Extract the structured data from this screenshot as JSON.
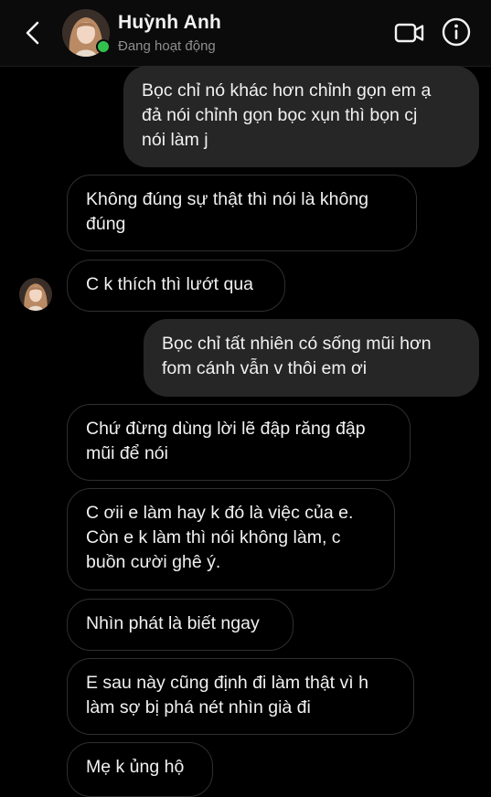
{
  "header": {
    "contact_name": "Huỳnh Anh",
    "status": "Đang hoạt động",
    "back_icon": "chevron-left-icon",
    "video_icon": "video-camera-icon",
    "info_icon": "info-icon",
    "online_color": "#31c24d"
  },
  "messages": [
    {
      "direction": "sent",
      "text": "Bọc chỉ nó khác hơn chỉnh gọn em ạ\nđả nói chỉnh gọn bọc xụn thì bọn cj\nnói làm j"
    },
    {
      "direction": "received",
      "text": "Không đúng sự thật thì nói là không\nđúng"
    },
    {
      "direction": "received",
      "text": "C k thích thì lướt qua"
    },
    {
      "direction": "sent",
      "text": "Bọc chỉ tất nhiên có sống mũi hơn\nfom cánh vẫn v thôi em ơi"
    },
    {
      "direction": "received",
      "text": "Chứ đừng dùng lời lẽ đập răng đập\nmũi để nói"
    },
    {
      "direction": "received",
      "text": "C ơii e làm hay k đó là việc của e.\nCòn e k làm thì nói không làm, c\nbuồn cười ghê ý."
    },
    {
      "direction": "received",
      "text": "Nhìn phát là biết ngay"
    },
    {
      "direction": "received",
      "text": "E sau này cũng định đi làm thật vì h\nlàm sợ bị phá nét nhìn già đi"
    },
    {
      "direction": "received",
      "text": "Mẹ k ủng hộ"
    }
  ],
  "colors": {
    "background": "#000000",
    "sent_bubble": "#262626",
    "received_border": "#2f2f2f"
  }
}
